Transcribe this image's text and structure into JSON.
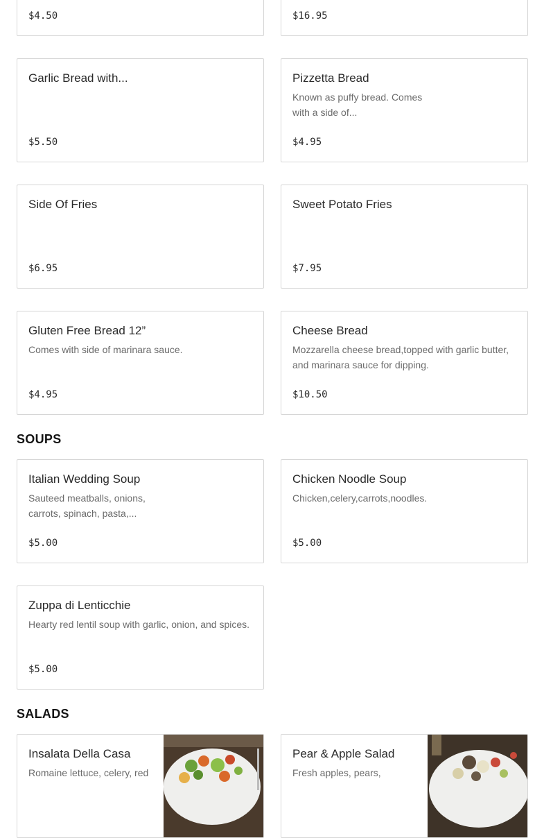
{
  "top_prices": {
    "left": "$4.50",
    "right": "$16.95"
  },
  "bread_items": [
    {
      "name": "Garlic Bread with...",
      "description": "",
      "price": "$5.50"
    },
    {
      "name": "Pizzetta Bread",
      "description": "Known as puffy bread. Comes with a side of...",
      "price": "$4.95"
    },
    {
      "name": "Side Of Fries",
      "description": "",
      "price": "$6.95"
    },
    {
      "name": "Sweet Potato Fries",
      "description": "",
      "price": "$7.95"
    },
    {
      "name": "Gluten Free Bread 12”",
      "description": "Comes with side of marinara sauce.",
      "price": "$4.95"
    },
    {
      "name": "Cheese Bread",
      "description": "Mozzarella cheese bread,topped with garlic butter, and marinara sauce for dipping.",
      "price": "$10.50"
    }
  ],
  "soups": {
    "heading": "SOUPS",
    "items": [
      {
        "name": "Italian Wedding Soup",
        "description": "Sauteed meatballs, onions, carrots, spinach, pasta,...",
        "price": "$5.00"
      },
      {
        "name": "Chicken Noodle Soup",
        "description": "Chicken,celery,carrots,noodles.",
        "price": "$5.00"
      },
      {
        "name": "Zuppa di Lenticchie",
        "description": "Hearty red lentil soup with garlic, onion, and spices.",
        "price": "$5.00"
      }
    ]
  },
  "salads": {
    "heading": "SALADS",
    "items": [
      {
        "name": "Insalata Della Casa",
        "description": "Romaine lettuce, celery, red"
      },
      {
        "name": "Pear & Apple Salad",
        "description": "Fresh apples, pears,"
      }
    ]
  }
}
